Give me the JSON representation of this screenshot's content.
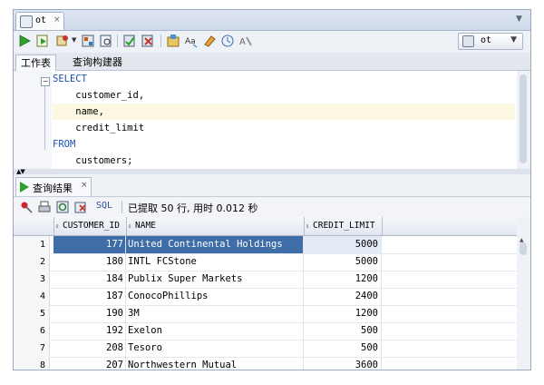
{
  "doc_tab": {
    "label": "ot",
    "close": "×"
  },
  "connection": {
    "label": "ot",
    "dropdown": "▼"
  },
  "worksheet_tabs": {
    "worksheet": "工作表",
    "query_builder": "查询构建器"
  },
  "editor": {
    "lines": [
      {
        "kw": "SELECT",
        "text": ""
      },
      {
        "kw": "",
        "text": "    customer_id,"
      },
      {
        "kw": "",
        "text": "    name,"
      },
      {
        "kw": "",
        "text": "    credit_limit"
      },
      {
        "kw": "FROM",
        "text": ""
      },
      {
        "kw": "",
        "text": "    customers;"
      }
    ],
    "fold_symbol": "−"
  },
  "results": {
    "tab_label": "查询结果",
    "tab_close": "×",
    "sql_label": "SQL",
    "status": "已提取 50 行, 用时 0.012 秒",
    "columns": [
      "CUSTOMER_ID",
      "NAME",
      "CREDIT_LIMIT"
    ],
    "rows": [
      {
        "n": "1",
        "id": "177",
        "name": "United Continental Holdings",
        "credit": "5000"
      },
      {
        "n": "2",
        "id": "180",
        "name": "INTL FCStone",
        "credit": "5000"
      },
      {
        "n": "3",
        "id": "184",
        "name": "Publix Super Markets",
        "credit": "1200"
      },
      {
        "n": "4",
        "id": "187",
        "name": "ConocoPhillips",
        "credit": "2400"
      },
      {
        "n": "5",
        "id": "190",
        "name": "3M",
        "credit": "1200"
      },
      {
        "n": "6",
        "id": "192",
        "name": "Exelon",
        "credit": "500"
      },
      {
        "n": "7",
        "id": "208",
        "name": "Tesoro",
        "credit": "500"
      },
      {
        "n": "8",
        "id": "207",
        "name": "Northwestern Mutual",
        "credit": "3600"
      }
    ]
  },
  "colors": {
    "accent": "#3e6da8",
    "keyword": "#1b4fb0",
    "run_green": "#2ea02e"
  }
}
